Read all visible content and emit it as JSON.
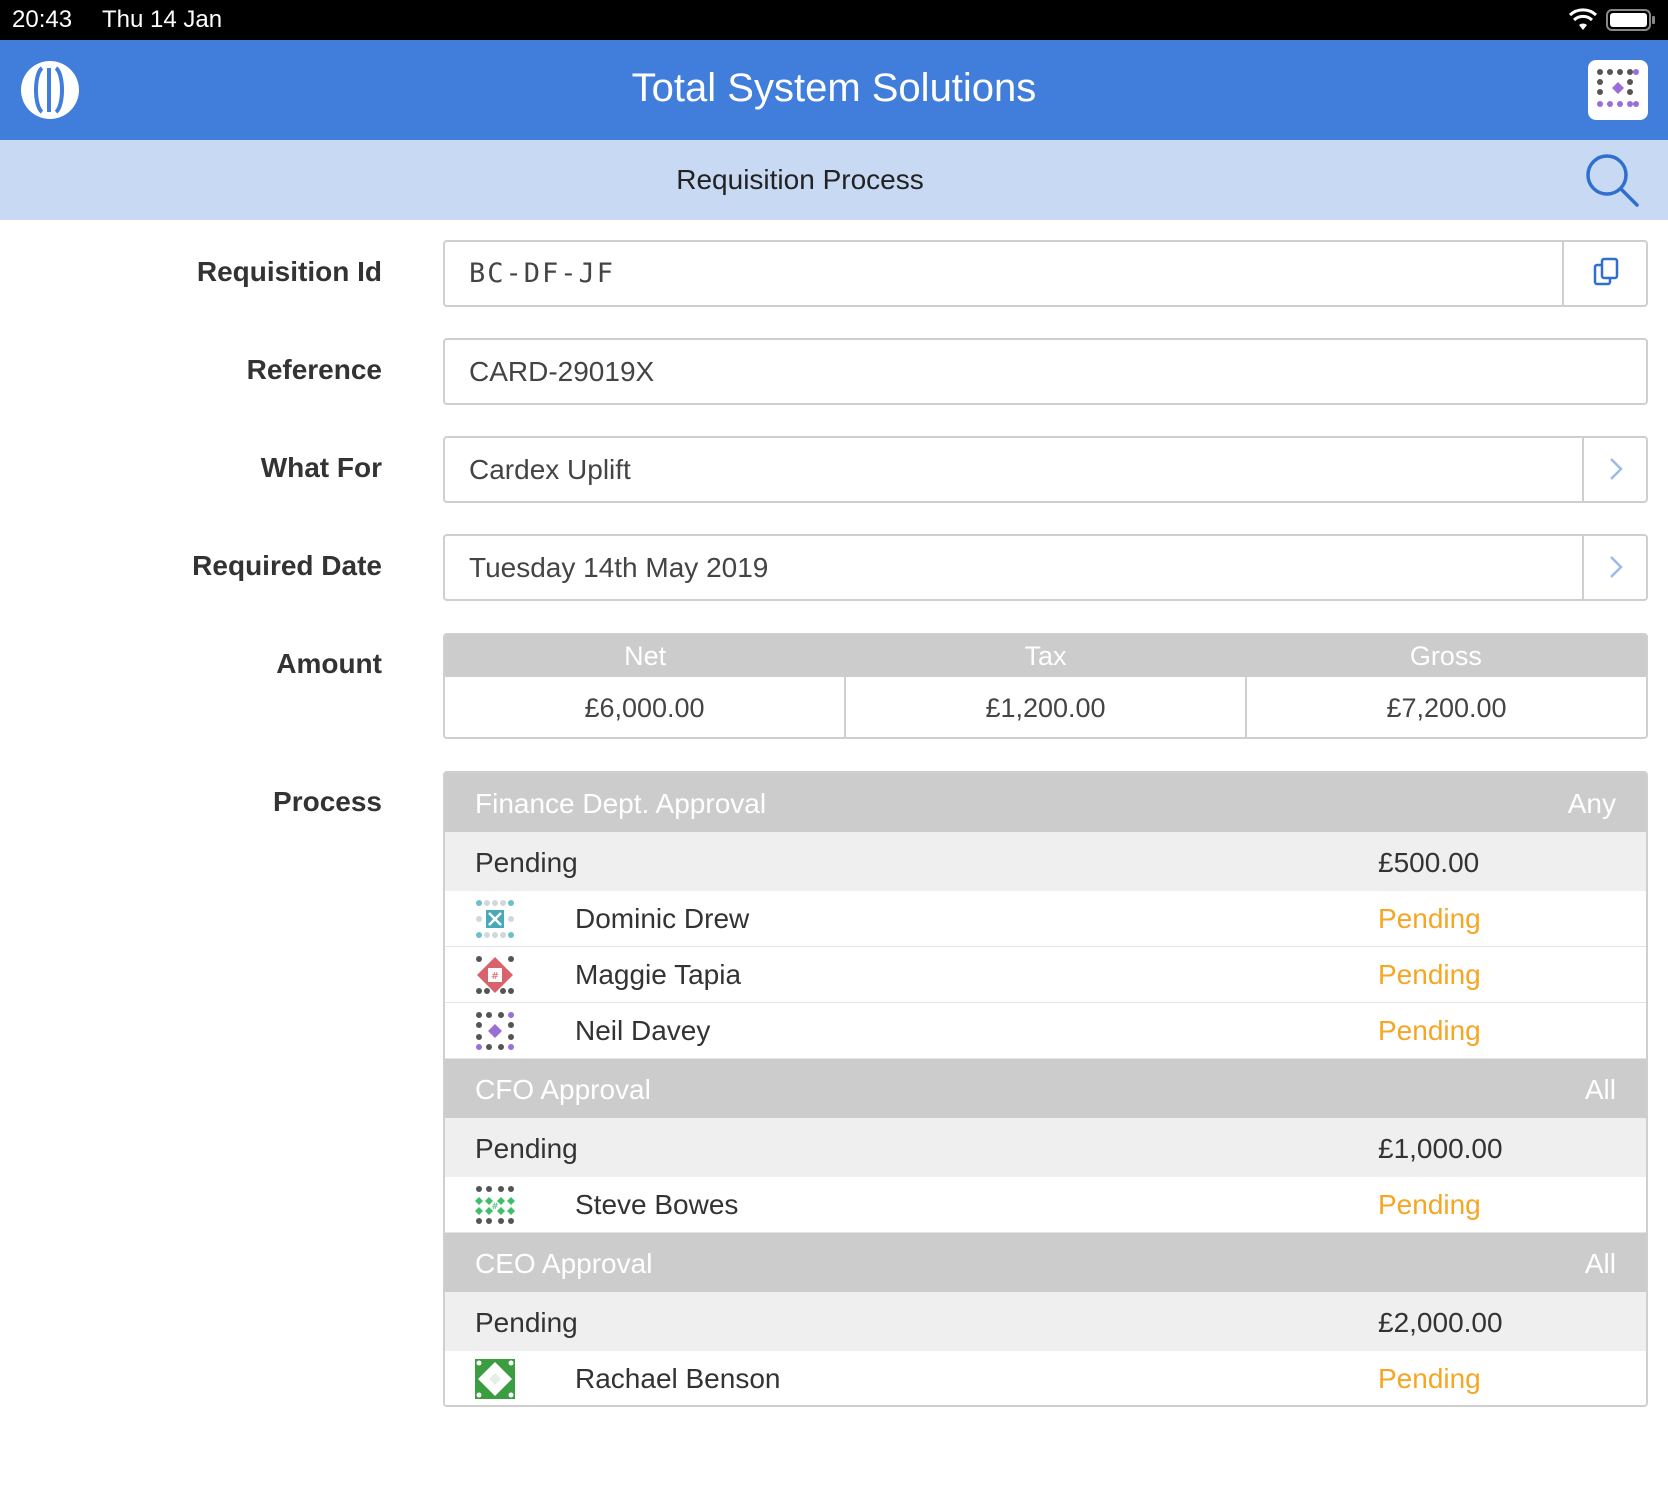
{
  "status_bar": {
    "time": "20:43",
    "date": "Thu 14 Jan"
  },
  "header": {
    "title": "Total System Solutions",
    "color": "#417ddb"
  },
  "subheader": {
    "title": "Requisition Process",
    "color": "#c8d9f4"
  },
  "form": {
    "requisition_id": {
      "label": "Requisition Id",
      "value": "BC-DF-JF"
    },
    "reference": {
      "label": "Reference",
      "value": "CARD-29019X"
    },
    "what_for": {
      "label": "What For",
      "value": "Cardex Uplift"
    },
    "required_date": {
      "label": "Required Date",
      "value": "Tuesday 14th May 2019"
    },
    "amount": {
      "label": "Amount",
      "headers": [
        "Net",
        "Tax",
        "Gross"
      ],
      "values": [
        "£6,000.00",
        "£1,200.00",
        "£7,200.00"
      ]
    },
    "process": {
      "label": "Process",
      "stages": [
        {
          "name": "Finance Dept. Approval",
          "rule": "Any",
          "status": "Pending",
          "amount": "£500.00",
          "approvers": [
            {
              "name": "Dominic Drew",
              "status": "Pending",
              "avatar_icon": "teal-pattern-avatar-icon"
            },
            {
              "name": "Maggie Tapia",
              "status": "Pending",
              "avatar_icon": "red-pattern-avatar-icon"
            },
            {
              "name": "Neil Davey",
              "status": "Pending",
              "avatar_icon": "purple-pattern-avatar-icon"
            }
          ]
        },
        {
          "name": "CFO Approval",
          "rule": "All",
          "status": "Pending",
          "amount": "£1,000.00",
          "approvers": [
            {
              "name": "Steve Bowes",
              "status": "Pending",
              "avatar_icon": "green-pattern-avatar-icon"
            }
          ]
        },
        {
          "name": "CEO Approval",
          "rule": "All",
          "status": "Pending",
          "amount": "£2,000.00",
          "approvers": [
            {
              "name": "Rachael Benson",
              "status": "Pending",
              "avatar_icon": "green-diamond-avatar-icon"
            }
          ]
        }
      ]
    }
  },
  "colors": {
    "pending": "#f5a623",
    "stage_header": "#cccccc"
  }
}
